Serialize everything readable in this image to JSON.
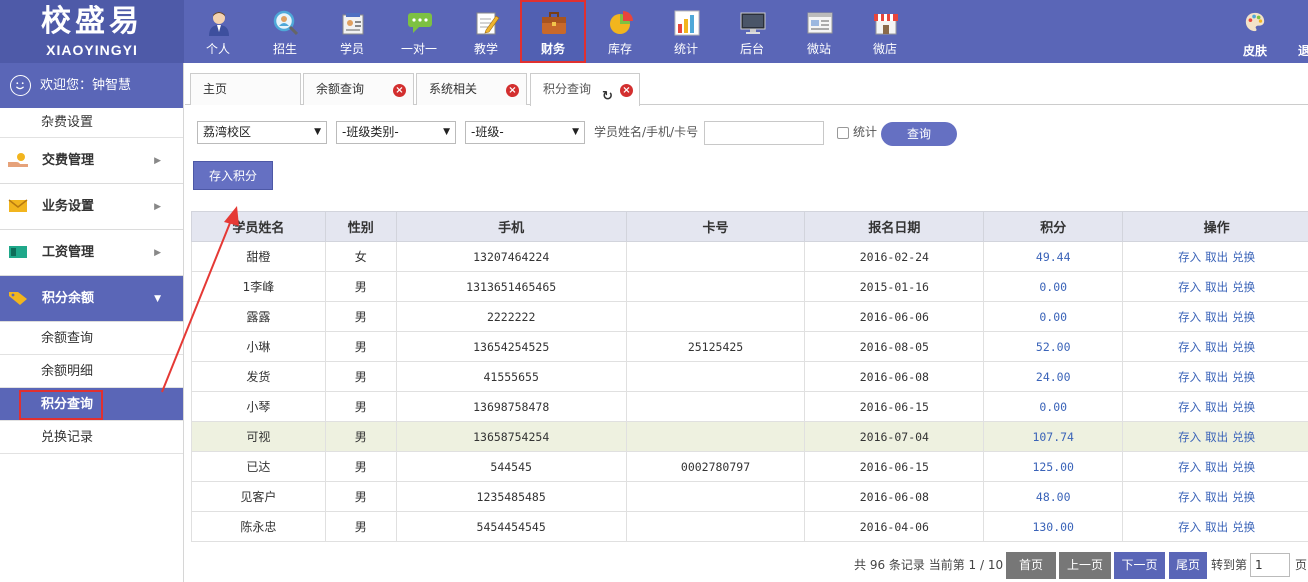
{
  "app": {
    "logo_cn": "校盛易",
    "logo_en": "XIAOYINGYI"
  },
  "nav": {
    "items": [
      {
        "label": "个人",
        "icon": "person-icon"
      },
      {
        "label": "招生",
        "icon": "magnifier-person-icon"
      },
      {
        "label": "学员",
        "icon": "student-card-icon"
      },
      {
        "label": "一对一",
        "icon": "chat-bubbles-icon"
      },
      {
        "label": "教学",
        "icon": "pencil-notebook-icon"
      },
      {
        "label": "财务",
        "icon": "briefcase-icon",
        "active": true
      },
      {
        "label": "库存",
        "icon": "pie-chart-icon"
      },
      {
        "label": "统计",
        "icon": "bar-chart-icon"
      },
      {
        "label": "后台",
        "icon": "monitor-icon"
      },
      {
        "label": "微站",
        "icon": "web-page-icon"
      },
      {
        "label": "微店",
        "icon": "shop-icon"
      }
    ],
    "skin_label": "皮肤",
    "exit_label": "退"
  },
  "sidebar": {
    "welcome": "欢迎您：钟智慧",
    "top_sub": "杂费设置",
    "menus": [
      {
        "label": "交费管理",
        "icon": "hand-coin-icon"
      },
      {
        "label": "业务设置",
        "icon": "envelope-icon"
      },
      {
        "label": "工资管理",
        "icon": "cash-icon"
      },
      {
        "label": "积分余额",
        "icon": "tag-icon",
        "open": true
      }
    ],
    "subs": [
      "余额查询",
      "余额明细",
      "积分查询",
      "兑换记录"
    ]
  },
  "tabs": [
    {
      "label": "主页"
    },
    {
      "label": "余额查询"
    },
    {
      "label": "系统相关"
    },
    {
      "label": "积分查询",
      "active": true
    }
  ],
  "filters": {
    "campus": "荔湾校区",
    "class_type": "-班级类别-",
    "class": "-班级-",
    "search_label": "学员姓名/手机/卡号",
    "search_value": "",
    "stat_label": "统计",
    "query_button": "查询",
    "save_button": "存入积分"
  },
  "table": {
    "headers": [
      "学员姓名",
      "性别",
      "手机",
      "卡号",
      "报名日期",
      "积分",
      "操作"
    ],
    "ops": [
      "存入",
      "取出",
      "兑换"
    ],
    "rows": [
      {
        "name": "甜橙",
        "gender": "女",
        "phone": "13207464224",
        "card": "",
        "date": "2016-02-24",
        "points": "49.44"
      },
      {
        "name": "1李峰",
        "gender": "男",
        "phone": "1313651465465",
        "card": "",
        "date": "2015-01-16",
        "points": "0.00"
      },
      {
        "name": "露露",
        "gender": "男",
        "phone": "2222222",
        "card": "",
        "date": "2016-06-06",
        "points": "0.00"
      },
      {
        "name": "小琳",
        "gender": "男",
        "phone": "13654254525",
        "card": "25125425",
        "date": "2016-08-05",
        "points": "52.00"
      },
      {
        "name": "发货",
        "gender": "男",
        "phone": "41555655",
        "card": "",
        "date": "2016-06-08",
        "points": "24.00"
      },
      {
        "name": "小琴",
        "gender": "男",
        "phone": "13698758478",
        "card": "",
        "date": "2016-06-15",
        "points": "0.00"
      },
      {
        "name": "可视",
        "gender": "男",
        "phone": "13658754254",
        "card": "",
        "date": "2016-07-04",
        "points": "107.74",
        "highlight": true
      },
      {
        "name": "已达",
        "gender": "男",
        "phone": "544545",
        "card": "0002780797",
        "date": "2016-06-15",
        "points": "125.00"
      },
      {
        "name": "见客户",
        "gender": "男",
        "phone": "1235485485",
        "card": "",
        "date": "2016-06-08",
        "points": "48.00"
      },
      {
        "name": "陈永忠",
        "gender": "男",
        "phone": "5454454545",
        "card": "",
        "date": "2016-04-06",
        "points": "130.00"
      }
    ]
  },
  "pager": {
    "info": "共 96 条记录 当前第 1 / 10",
    "first": "首页",
    "prev": "上一页",
    "next": "下一页",
    "last": "尾页",
    "goto_label": "转到第",
    "page_value": "1",
    "page_suffix": "页"
  }
}
